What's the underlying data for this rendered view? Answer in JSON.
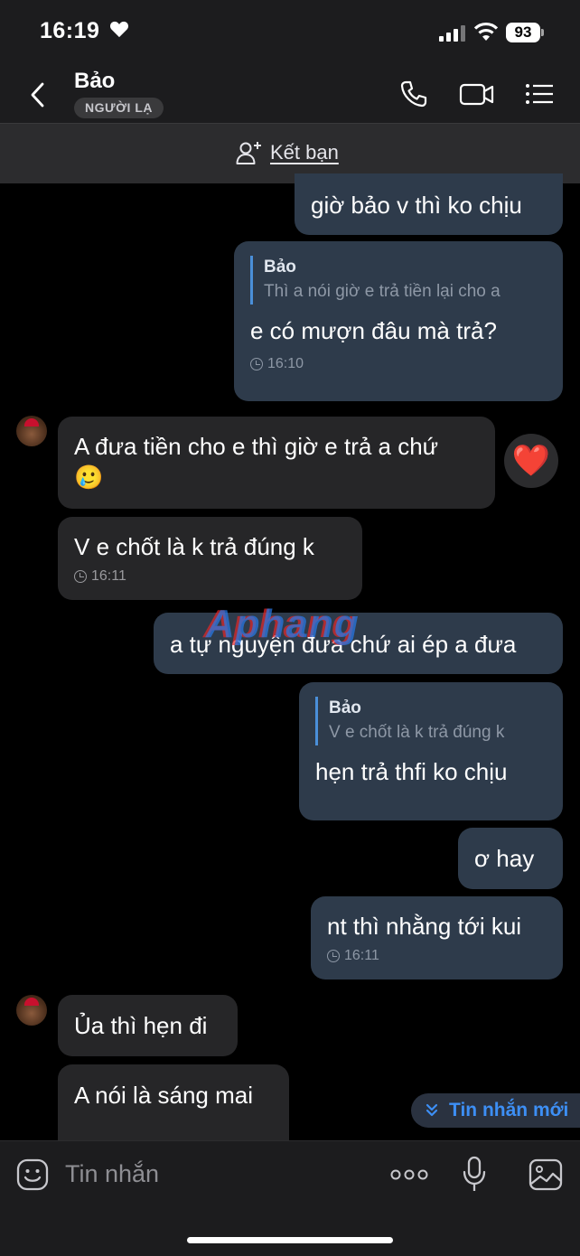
{
  "status_bar": {
    "time": "16:19",
    "battery": "93"
  },
  "header": {
    "contact_name": "Bảo",
    "badge": "NGƯỜI LẠ"
  },
  "add_friend": {
    "label": "Kết bạn"
  },
  "messages": [
    {
      "direction": "out",
      "text": "giờ bảo v thì ko chịu"
    },
    {
      "direction": "out",
      "quote_name": "Bảo",
      "quote_text": "Thì a nói giờ e trả tiền lại cho a",
      "text": "e có mượn đâu mà trả?",
      "time": "16:10"
    },
    {
      "direction": "in",
      "text": "A đưa tiền cho e thì giờ e trả a chứ",
      "emoji": "🥲",
      "reaction": "❤️"
    },
    {
      "direction": "in",
      "text": "V e chốt là k trả đúng k",
      "time": "16:11"
    },
    {
      "direction": "out",
      "text": "a tự nguyện đưa chứ ai ép a đưa"
    },
    {
      "direction": "out",
      "quote_name": "Bảo",
      "quote_text": "V e chốt là k trả đúng k",
      "text": "hẹn trả thfi ko chịu"
    },
    {
      "direction": "out",
      "text": "ơ hay"
    },
    {
      "direction": "out",
      "text": "nt thì nhằng tới kui",
      "time": "16:11"
    },
    {
      "direction": "in",
      "text": "Ủa thì hẹn đi"
    },
    {
      "direction": "in",
      "text": "A nói là sáng mai"
    }
  ],
  "watermark": "Aphang",
  "new_messages_pill": {
    "label": "Tin nhắn mới"
  },
  "composer": {
    "placeholder": "Tin nhắn"
  },
  "icons": {
    "back": "chevron-left-icon",
    "call": "phone-icon",
    "video": "video-camera-icon",
    "menu": "list-icon",
    "add_friend": "add-user-icon",
    "sticker": "sticker-icon",
    "more": "more-dots-icon",
    "mic": "microphone-icon",
    "gallery": "image-icon",
    "new_messages": "double-chevron-down-icon"
  },
  "colors": {
    "accent": "#3d8ff5",
    "outgoing_bubble": "#2e3b4b",
    "incoming_bubble": "#262628",
    "background": "#000000"
  }
}
